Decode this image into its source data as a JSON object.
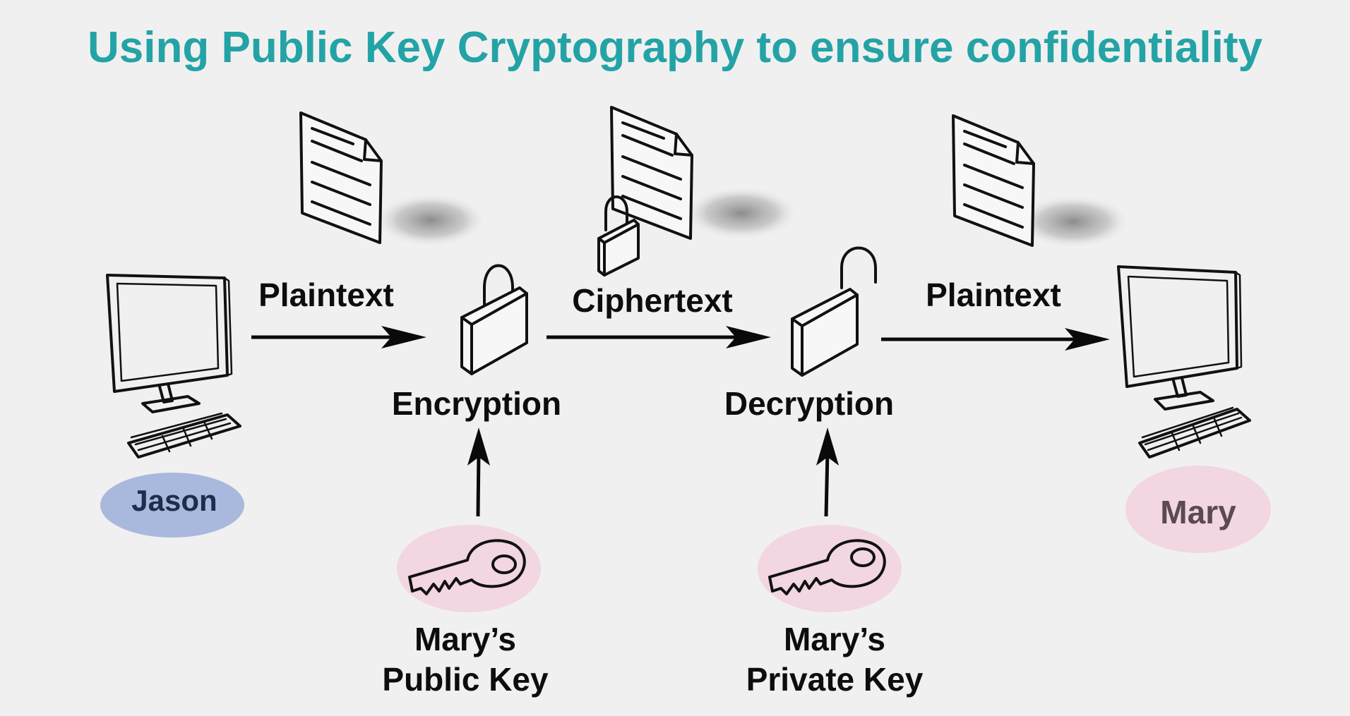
{
  "title": "Using Public Key Cryptography to ensure confidentiality",
  "labels": {
    "plaintext_left": "Plaintext",
    "ciphertext": "Ciphertext",
    "plaintext_right": "Plaintext",
    "encryption": "Encryption",
    "decryption": "Decryption",
    "public_key_line1": "Mary’s",
    "public_key_line2": "Public Key",
    "private_key_line1": "Mary’s",
    "private_key_line2": "Private Key"
  },
  "actors": {
    "sender": "Jason",
    "recipient": "Mary"
  },
  "colors": {
    "title": "#24a3a6",
    "sender_bubble": "#a9b8dd",
    "recipient_bubble": "#f2d6e2",
    "key_bubble": "#f2d6e2"
  },
  "icons": {
    "computer": "computer-icon",
    "document": "document-icon",
    "lock_closed": "padlock-closed-icon",
    "lock_open": "padlock-open-icon",
    "key": "key-icon"
  }
}
